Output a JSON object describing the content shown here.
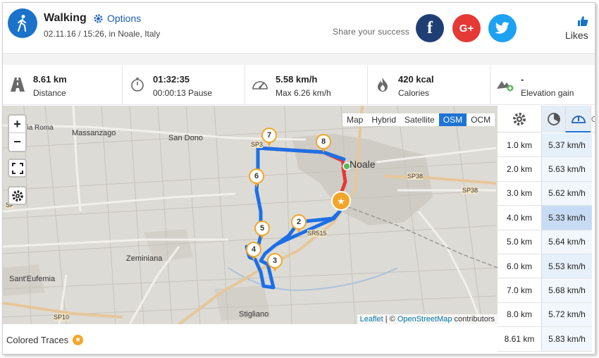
{
  "header": {
    "title": "Walking",
    "options_label": "Options",
    "subtitle": "02.11.16 / 15:26, in Noale, Italy",
    "share_text": "Share your success",
    "social": {
      "facebook": "f",
      "google": "G+",
      "twitter": "twitter"
    },
    "likes_label": "Likes"
  },
  "stats": [
    {
      "icon": "road-icon",
      "value": "8.61 km",
      "label": "Distance"
    },
    {
      "icon": "stopwatch-icon",
      "value": "01:32:35",
      "label": "00:00:13 Pause"
    },
    {
      "icon": "speedometer-icon",
      "value": "5.58 km/h",
      "label": "Max 6.26 km/h"
    },
    {
      "icon": "flame-icon",
      "value": "420 kcal",
      "label": "Calories"
    },
    {
      "icon": "mountain-icon",
      "value": "-",
      "label": "Elevation gain"
    }
  ],
  "map": {
    "zoom_in": "+",
    "zoom_out": "−",
    "layers": [
      "Map",
      "Hybrid",
      "Satellite",
      "OSM",
      "OCM"
    ],
    "active_layer": "OSM",
    "attribution": {
      "leaflet": "Leaflet",
      "sep": " | © ",
      "osm": "OpenStreetMap",
      "rest": " contributors"
    },
    "labels": {
      "via_roma": "Via Roma",
      "massanzago": "Massanzago",
      "san_dono": "San Dono",
      "noale": "Noale",
      "sp38a": "SP38",
      "sp38b": "SP38",
      "sr515": "SR515",
      "zeminiana": "Zeminiana",
      "sant_eufemia": "Sant'Eufemia",
      "stigliano": "Stigliano",
      "sp10": "SP10",
      "sp3": "SP3",
      "sp_left": "SP"
    },
    "markers": [
      "2",
      "3",
      "4",
      "5",
      "6",
      "7",
      "8"
    ]
  },
  "traces": {
    "label": "Colored Traces",
    "badge": "★"
  },
  "table": {
    "rows": [
      {
        "km": "1.0 km",
        "speed": "5.37 km/h"
      },
      {
        "km": "2.0 km",
        "speed": "5.63 km/h"
      },
      {
        "km": "3.0 km",
        "speed": "5.62 km/h"
      },
      {
        "km": "4.0 km",
        "speed": "5.33 km/h"
      },
      {
        "km": "5.0 km",
        "speed": "5.64 km/h"
      },
      {
        "km": "6.0 km",
        "speed": "5.53 km/h"
      },
      {
        "km": "7.0 km",
        "speed": "5.68 km/h"
      },
      {
        "km": "8.0 km",
        "speed": "5.72 km/h"
      },
      {
        "km": "8.61 km",
        "speed": "5.83 km/h"
      }
    ]
  },
  "colors": {
    "accent": "#1a73c8",
    "route": "#1d6fe6",
    "route_end": "#e53935",
    "marker": "#f2a62a",
    "facebook": "#1f3f74",
    "google": "#e53935",
    "twitter": "#1da1f2"
  }
}
